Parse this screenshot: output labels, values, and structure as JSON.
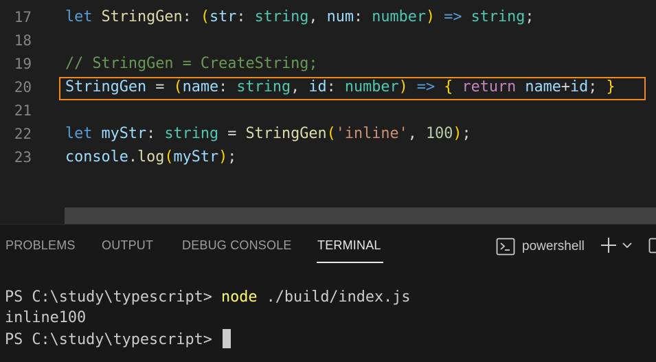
{
  "editor": {
    "lines": [
      {
        "num": "17",
        "tokens": [
          {
            "t": "let",
            "c": "kw"
          },
          {
            "t": " ",
            "c": "op"
          },
          {
            "t": "StringGen",
            "c": "fn"
          },
          {
            "t": ": ",
            "c": "op"
          },
          {
            "t": "(",
            "c": "br"
          },
          {
            "t": "str",
            "c": "vr"
          },
          {
            "t": ": ",
            "c": "op"
          },
          {
            "t": "string",
            "c": "ty"
          },
          {
            "t": ", ",
            "c": "op"
          },
          {
            "t": "num",
            "c": "vr"
          },
          {
            "t": ": ",
            "c": "op"
          },
          {
            "t": "number",
            "c": "ty"
          },
          {
            "t": ")",
            "c": "br"
          },
          {
            "t": " ",
            "c": "op"
          },
          {
            "t": "=>",
            "c": "kw"
          },
          {
            "t": " ",
            "c": "op"
          },
          {
            "t": "string",
            "c": "ty"
          },
          {
            "t": ";",
            "c": "op"
          }
        ]
      },
      {
        "num": "18",
        "tokens": []
      },
      {
        "num": "19",
        "tokens": [
          {
            "t": "// StringGen = CreateString;",
            "c": "cm"
          }
        ]
      },
      {
        "num": "20",
        "tokens": [
          {
            "t": "StringGen",
            "c": "vr"
          },
          {
            "t": " = ",
            "c": "op"
          },
          {
            "t": "(",
            "c": "br"
          },
          {
            "t": "name",
            "c": "vr"
          },
          {
            "t": ": ",
            "c": "op"
          },
          {
            "t": "string",
            "c": "ty"
          },
          {
            "t": ", ",
            "c": "op"
          },
          {
            "t": "id",
            "c": "vr"
          },
          {
            "t": ": ",
            "c": "op"
          },
          {
            "t": "number",
            "c": "ty"
          },
          {
            "t": ")",
            "c": "br"
          },
          {
            "t": " ",
            "c": "op"
          },
          {
            "t": "=>",
            "c": "kw"
          },
          {
            "t": " ",
            "c": "op"
          },
          {
            "t": "{",
            "c": "br"
          },
          {
            "t": " ",
            "c": "op"
          },
          {
            "t": "return",
            "c": "kwc"
          },
          {
            "t": " ",
            "c": "op"
          },
          {
            "t": "name",
            "c": "vr"
          },
          {
            "t": "+",
            "c": "op"
          },
          {
            "t": "id",
            "c": "vr"
          },
          {
            "t": "; ",
            "c": "op"
          },
          {
            "t": "}",
            "c": "br"
          }
        ]
      },
      {
        "num": "21",
        "tokens": []
      },
      {
        "num": "22",
        "tokens": [
          {
            "t": "let",
            "c": "kw"
          },
          {
            "t": " ",
            "c": "op"
          },
          {
            "t": "myStr",
            "c": "vr"
          },
          {
            "t": ": ",
            "c": "op"
          },
          {
            "t": "string",
            "c": "ty"
          },
          {
            "t": " = ",
            "c": "op"
          },
          {
            "t": "StringGen",
            "c": "fn"
          },
          {
            "t": "(",
            "c": "br"
          },
          {
            "t": "'inline'",
            "c": "st"
          },
          {
            "t": ", ",
            "c": "op"
          },
          {
            "t": "100",
            "c": "nm"
          },
          {
            "t": ")",
            "c": "br"
          },
          {
            "t": ";",
            "c": "op"
          }
        ]
      },
      {
        "num": "23",
        "tokens": [
          {
            "t": "console",
            "c": "vr"
          },
          {
            "t": ".",
            "c": "op"
          },
          {
            "t": "log",
            "c": "fn"
          },
          {
            "t": "(",
            "c": "br"
          },
          {
            "t": "myStr",
            "c": "vr"
          },
          {
            "t": ")",
            "c": "br"
          },
          {
            "t": ";",
            "c": "op"
          }
        ]
      }
    ],
    "highlight_color": "#f0891f"
  },
  "panel": {
    "tabs": {
      "problems": "PROBLEMS",
      "output": "OUTPUT",
      "debug_console": "DEBUG CONSOLE",
      "terminal": "TERMINAL"
    },
    "active_tab": "TERMINAL",
    "shell": "powershell",
    "icons": {
      "terminal": "terminal-icon",
      "new_terminal": "plus-icon",
      "dropdown": "chevron-down-icon",
      "split": "split-terminal-icon"
    }
  },
  "terminal": {
    "line1_prompt": "PS C:\\study\\typescript> ",
    "line1_cmd": "node",
    "line1_args": " ./build/index.js",
    "line2": "inline100",
    "line3_prompt": "PS C:\\study\\typescript> "
  }
}
